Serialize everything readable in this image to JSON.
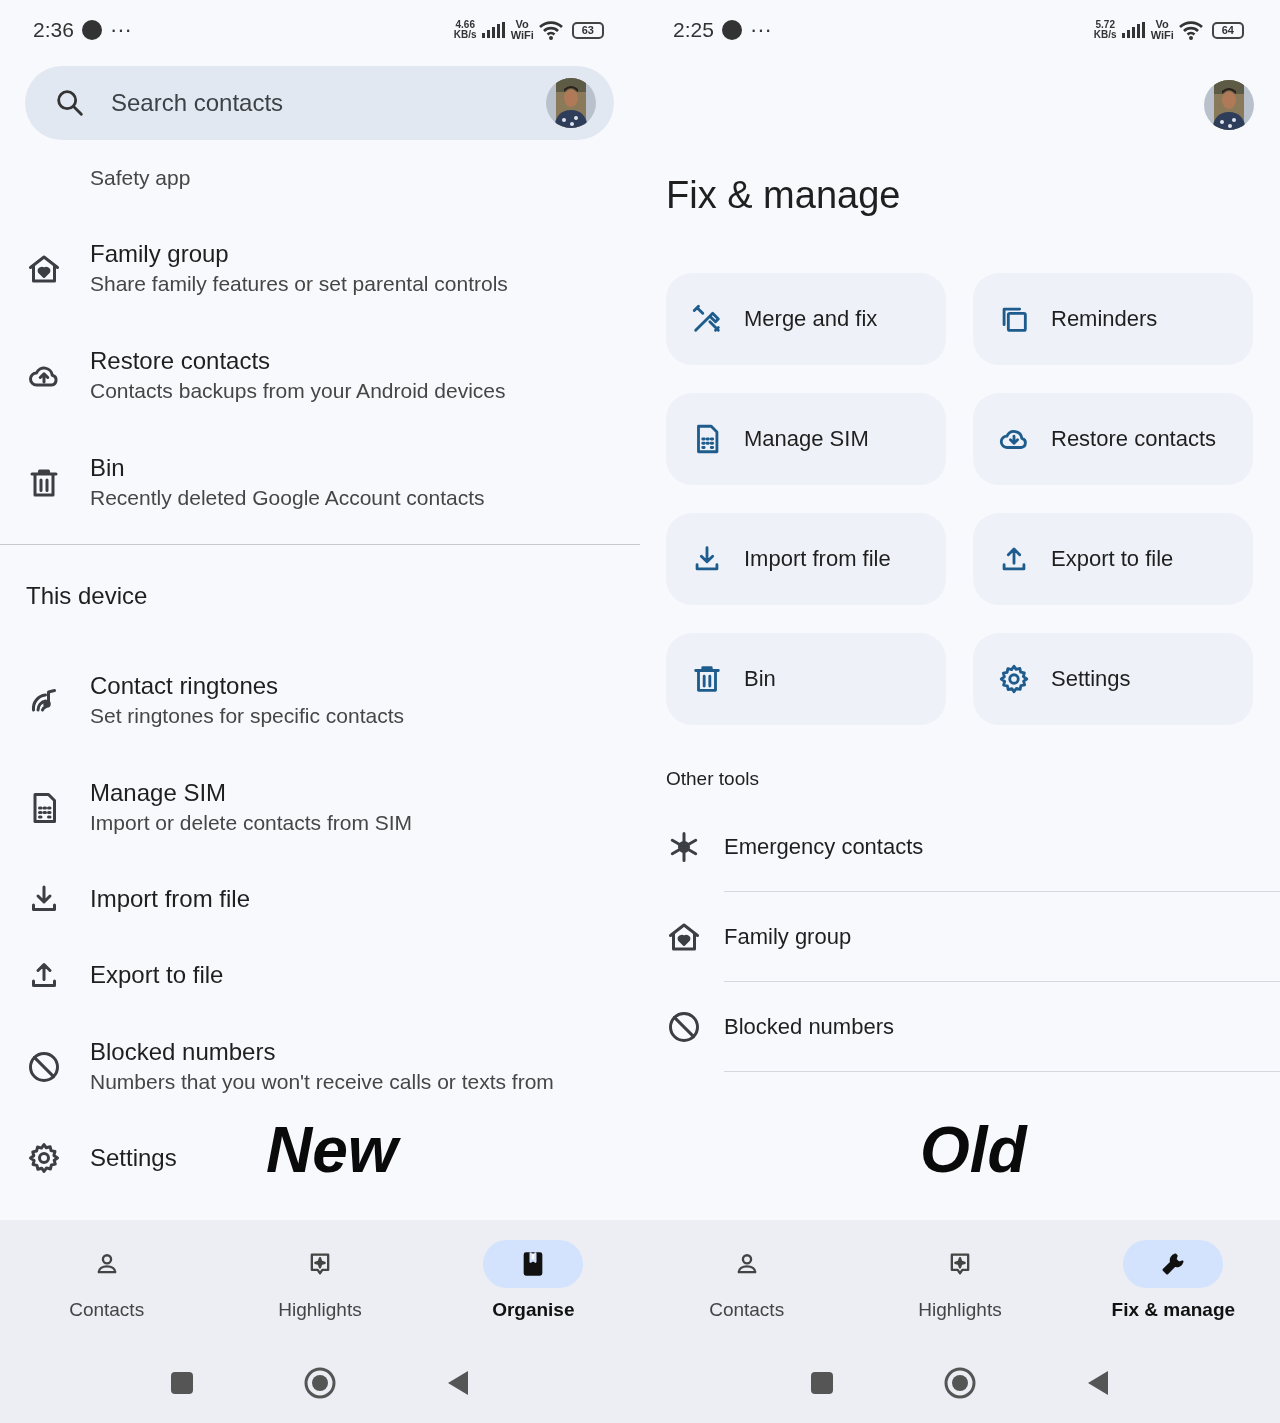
{
  "new_screen": {
    "status_bar": {
      "time": "2:36",
      "more": "···",
      "speed": "4.66",
      "speed_unit": "KB/s",
      "volte": "Vo",
      "wifi": "WiFi",
      "battery": "63"
    },
    "search": {
      "placeholder": "Search contacts"
    },
    "items": [
      {
        "subtitle": "Safety app"
      },
      {
        "title": "Family group",
        "subtitle": "Share family features or set parental controls"
      },
      {
        "title": "Restore contacts",
        "subtitle": "Contacts backups from your Android devices"
      },
      {
        "title": "Bin",
        "subtitle": "Recently deleted Google Account contacts"
      }
    ],
    "section": "This device",
    "device_items": [
      {
        "title": "Contact ringtones",
        "subtitle": "Set ringtones for specific contacts"
      },
      {
        "title": "Manage SIM",
        "subtitle": "Import or delete contacts from SIM"
      },
      {
        "title": "Import from file"
      },
      {
        "title": "Export to file"
      },
      {
        "title": "Blocked numbers",
        "subtitle": "Numbers that you won't receive calls or texts from"
      },
      {
        "title": "Settings"
      }
    ],
    "caption": "New",
    "nav": [
      {
        "label": "Contacts",
        "selected": false
      },
      {
        "label": "Highlights",
        "selected": false
      },
      {
        "label": "Organise",
        "selected": true
      }
    ]
  },
  "old_screen": {
    "status_bar": {
      "time": "2:25",
      "more": "···",
      "speed": "5.72",
      "speed_unit": "KB/s",
      "volte": "Vo",
      "wifi": "WiFi",
      "battery": "64"
    },
    "title": "Fix & manage",
    "tiles": [
      {
        "label": "Merge and fix"
      },
      {
        "label": "Reminders"
      },
      {
        "label": "Manage SIM"
      },
      {
        "label": "Restore contacts"
      },
      {
        "label": "Import from file"
      },
      {
        "label": "Export to file"
      },
      {
        "label": "Bin"
      },
      {
        "label": "Settings"
      }
    ],
    "section": "Other tools",
    "tools": [
      {
        "label": "Emergency contacts"
      },
      {
        "label": "Family group"
      },
      {
        "label": "Blocked numbers"
      }
    ],
    "caption": "Old",
    "nav": [
      {
        "label": "Contacts",
        "selected": false
      },
      {
        "label": "Highlights",
        "selected": false
      },
      {
        "label": "Fix & manage",
        "selected": true
      }
    ]
  }
}
